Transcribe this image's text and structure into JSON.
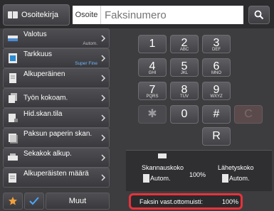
{
  "header": {
    "address_book_label": "Osoitekirja",
    "address_label": "Osoite",
    "fax_number_placeholder": "Faksinumero"
  },
  "sidebar": {
    "items": [
      {
        "label": "Valotus",
        "value": "Autom.",
        "icon": "exposure-icon"
      },
      {
        "label": "Tarkkuus",
        "value": "Super Fine",
        "icon": "resolution-icon"
      },
      {
        "label": "Alkuperäinen",
        "value": "",
        "icon": "original-icon"
      },
      {
        "label": "Työn kokoam.",
        "value": "",
        "icon": "job-build-icon"
      },
      {
        "label": "Hid.skan.tila",
        "value": "",
        "icon": "slow-scan-icon"
      },
      {
        "label": "Paksun paperin skan.",
        "value": "",
        "icon": "thick-paper-icon"
      },
      {
        "label": "Sekakok alkup.",
        "value": "",
        "icon": "mixed-size-icon"
      },
      {
        "label": "Alkuperäisten määrä",
        "value": "",
        "icon": "original-count-icon"
      }
    ]
  },
  "bottom": {
    "more_label": "Muut"
  },
  "keypad": {
    "keys": [
      {
        "digit": "1",
        "sub": ""
      },
      {
        "digit": "2",
        "sub": "ABC"
      },
      {
        "digit": "3",
        "sub": "DEF"
      },
      {
        "digit": "4",
        "sub": "GHI"
      },
      {
        "digit": "5",
        "sub": "JKL"
      },
      {
        "digit": "6",
        "sub": "MNO"
      },
      {
        "digit": "7",
        "sub": "PQRS"
      },
      {
        "digit": "8",
        "sub": "TUV"
      },
      {
        "digit": "9",
        "sub": "WXYZ"
      },
      {
        "digit": "✱",
        "sub": ""
      },
      {
        "digit": "0",
        "sub": ""
      },
      {
        "digit": "#",
        "sub": ""
      },
      {
        "digit": "C",
        "sub": ""
      },
      {
        "digit": "R",
        "sub": ""
      }
    ]
  },
  "info": {
    "scan_size_label": "Skannauskoko",
    "scan_size_value": "Autom.",
    "ratio": "100%",
    "send_size_label": "Lähetyskoko",
    "send_size_value": "Autom."
  },
  "memory": {
    "label": "Faksin vast.ottomuisti:",
    "value": "100%"
  },
  "colors": {
    "highlight": "#e8323a",
    "fine_blue": "#6db5ff",
    "favorite_orange": "#f2a03a",
    "check_blue": "#4aa6ff"
  }
}
